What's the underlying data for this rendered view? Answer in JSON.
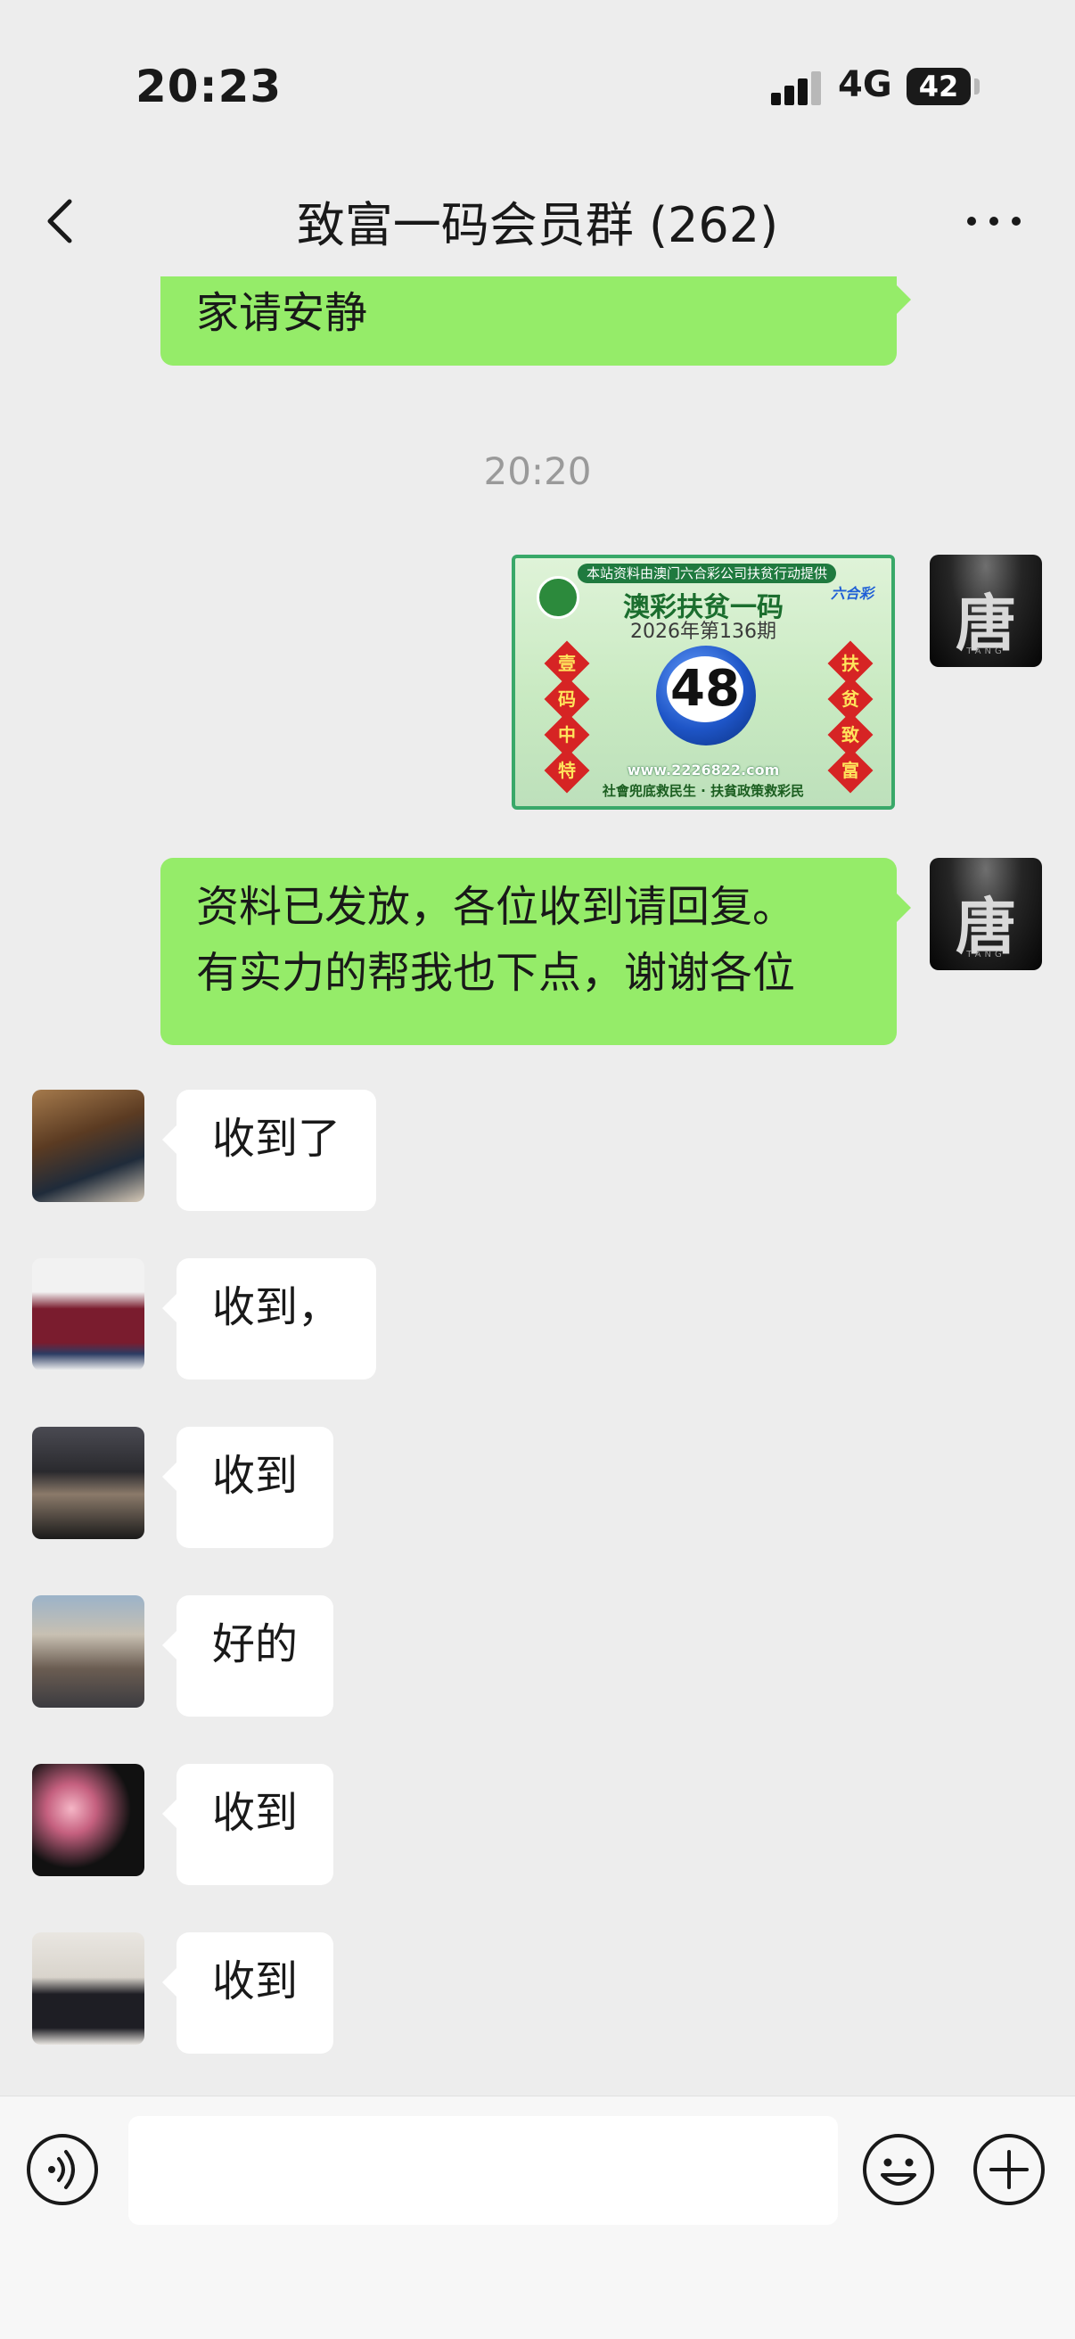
{
  "status_bar": {
    "time": "20:23",
    "network": "4G",
    "battery": "42"
  },
  "nav": {
    "title": "致富一码会员群 (262)"
  },
  "messages": {
    "m0": {
      "text": "家请安静"
    },
    "time_divider": "20:20",
    "poster": {
      "banner": "本站资料由澳门六合彩公司扶贫行动提供",
      "title": "澳彩扶贫一码",
      "issue": "2026年第136期",
      "number": "48",
      "left_chars": [
        "壹",
        "码",
        "中",
        "特"
      ],
      "right_chars": [
        "扶",
        "贫",
        "致",
        "富"
      ],
      "url": "www.2226822.com",
      "slogan": "社會兜底救民生 · 扶貧政策救彩民",
      "logo": "六合彩"
    },
    "m2": {
      "line1": "资料已发放，各位收到请回复。",
      "line2": "有实力的帮我也下点，谢谢各位"
    },
    "replies": [
      {
        "text": "收到了"
      },
      {
        "text": "收到，"
      },
      {
        "text": "收到"
      },
      {
        "text": "好的"
      },
      {
        "text": "收到"
      },
      {
        "text": "收到"
      }
    ]
  },
  "avatars": {
    "me_glyph": "唐",
    "me_sub": "TANG"
  },
  "colors": {
    "my_bubble": "#95ec69",
    "other_bubble": "#ffffff",
    "background": "#ededed"
  },
  "icons": [
    "back-arrow",
    "more-dots",
    "voice",
    "emoji",
    "plus"
  ]
}
